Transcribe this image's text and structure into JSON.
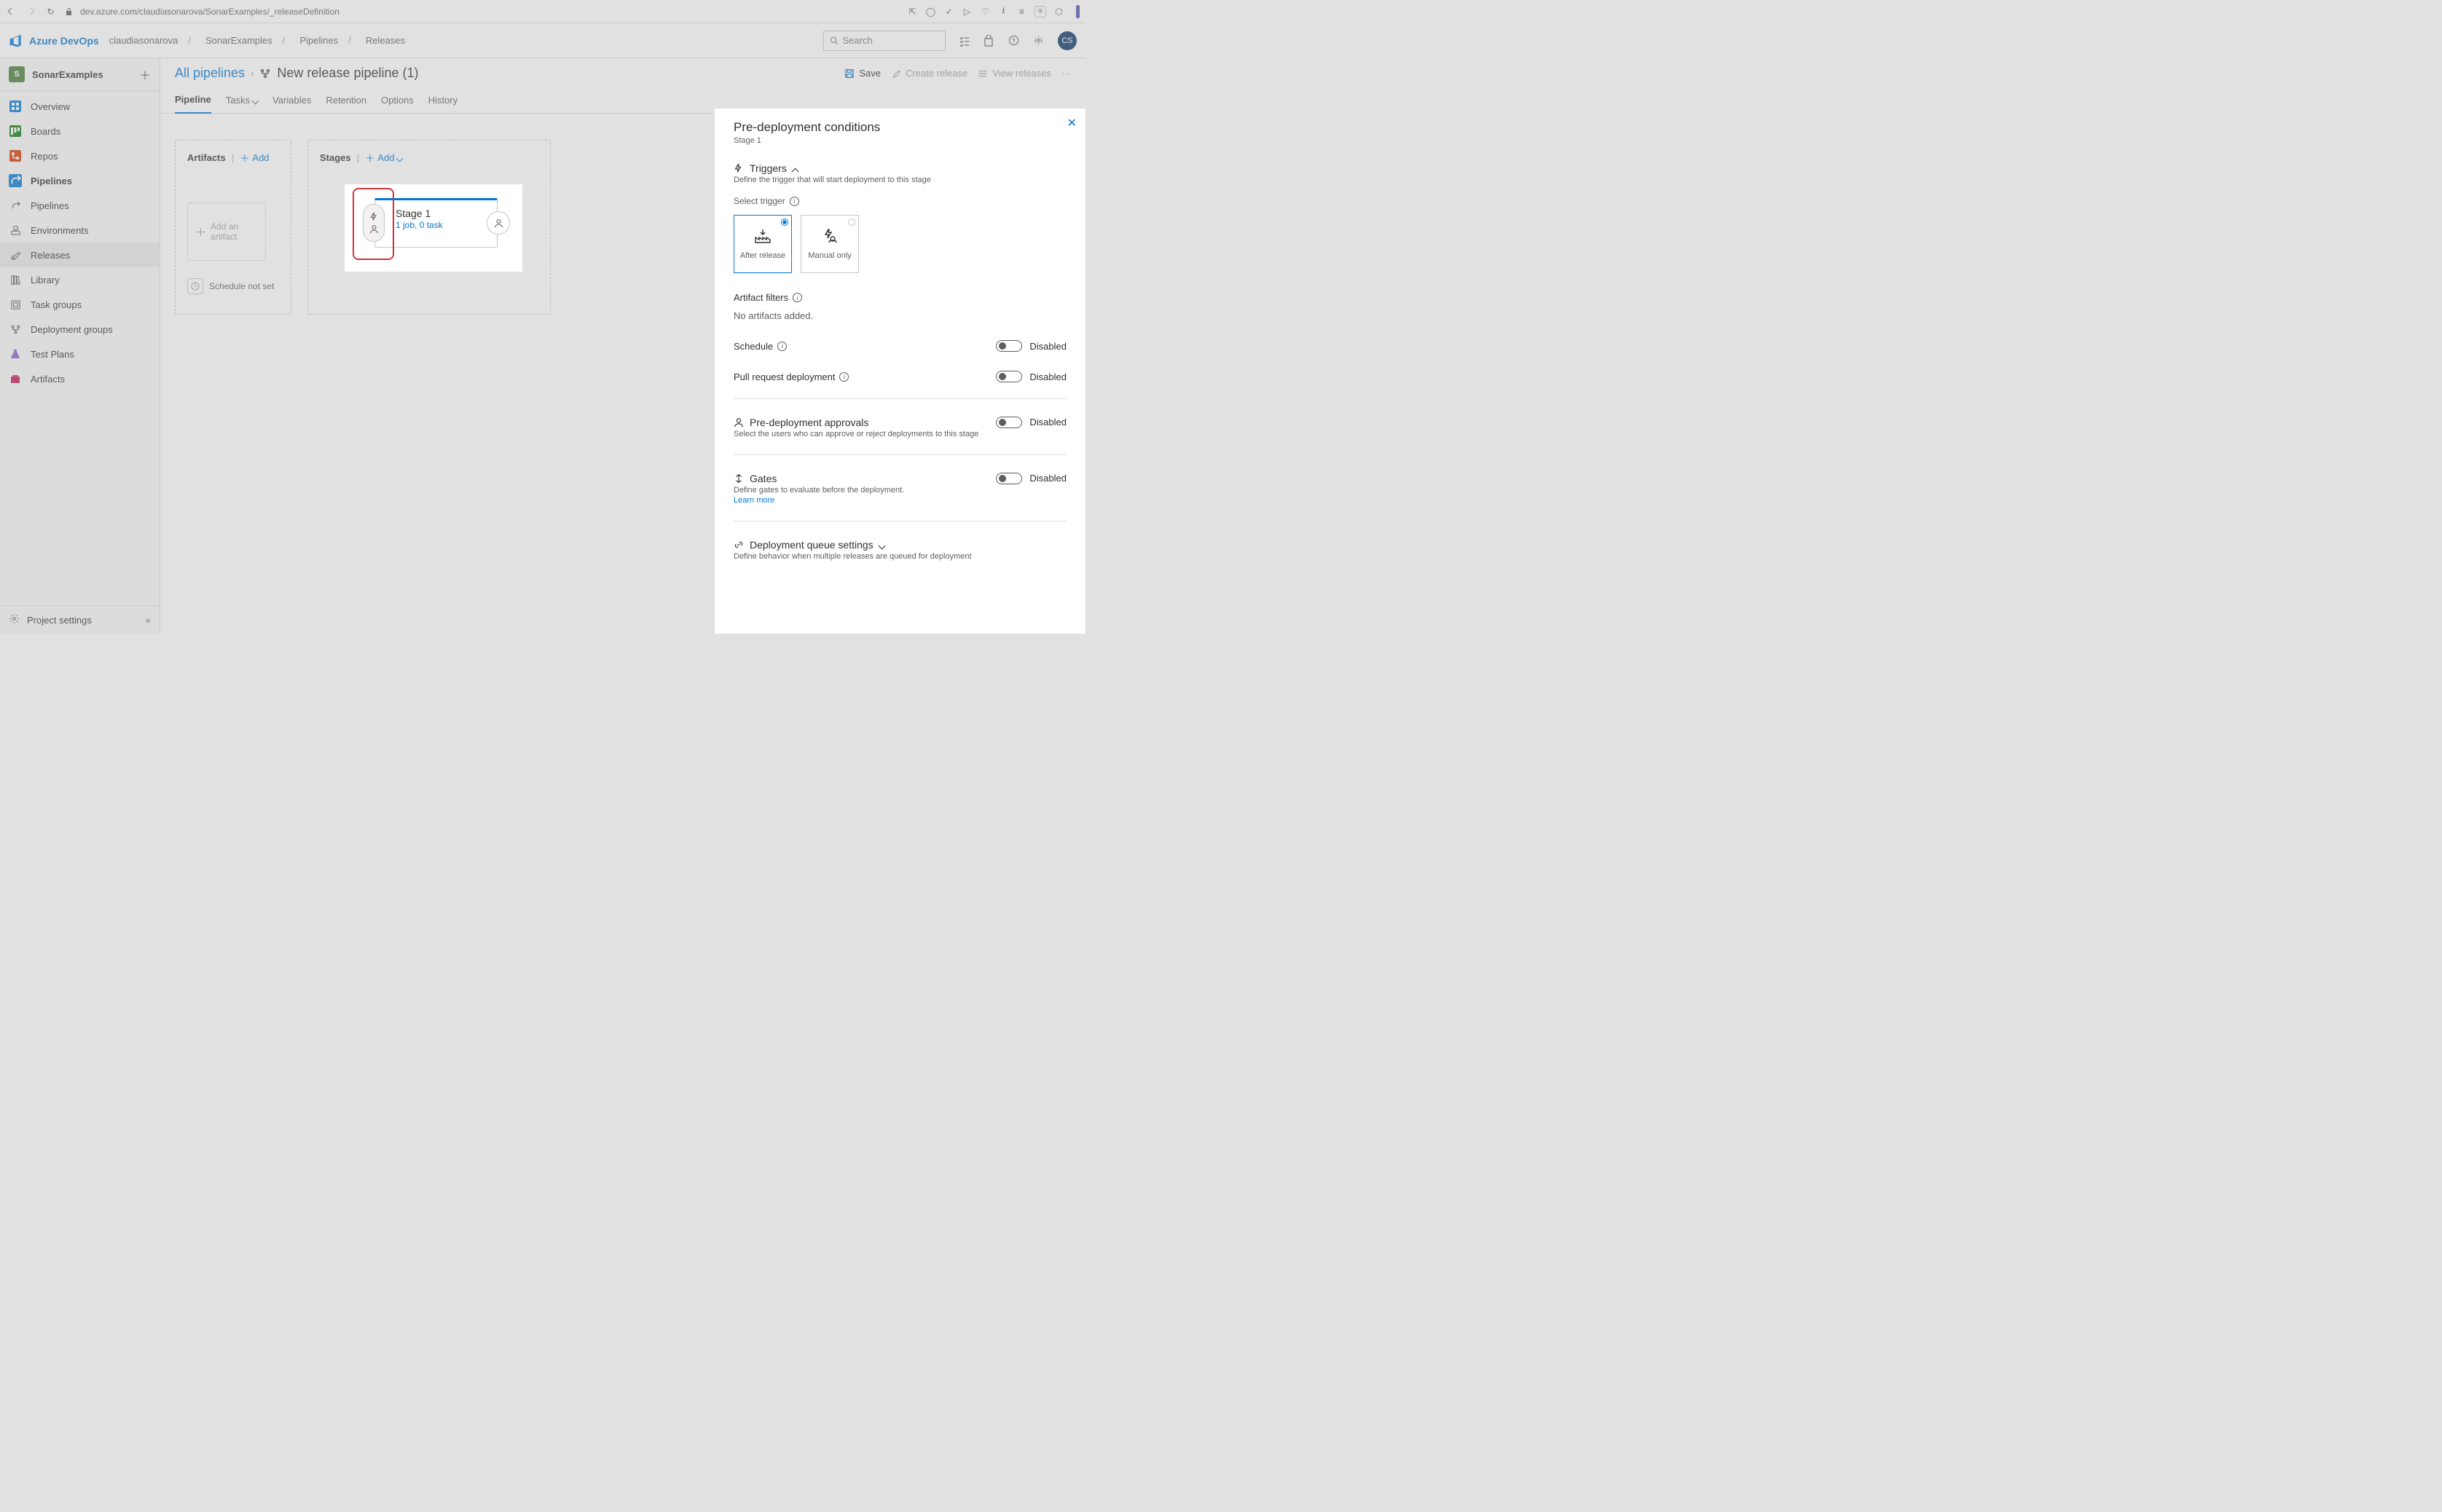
{
  "browser": {
    "url": "dev.azure.com/claudiasonarova/SonarExamples/_releaseDefinition"
  },
  "header": {
    "brand": "Azure DevOps",
    "org": "claudiasonarova",
    "project": "SonarExamples",
    "section": "Pipelines",
    "subsection": "Releases",
    "search_placeholder": "Search",
    "avatar": "CS"
  },
  "sidebar": {
    "project_initial": "S",
    "project_name": "SonarExamples",
    "items": {
      "overview": "Overview",
      "boards": "Boards",
      "repos": "Repos",
      "pipelines": "Pipelines",
      "pipelines_sub": "Pipelines",
      "environments": "Environments",
      "releases": "Releases",
      "library": "Library",
      "task_groups": "Task groups",
      "deployment_groups": "Deployment groups",
      "test_plans": "Test Plans",
      "artifacts": "Artifacts"
    },
    "project_settings": "Project settings"
  },
  "breadcrumb": {
    "all": "All pipelines",
    "title": "New release pipeline (1)"
  },
  "actions": {
    "save": "Save",
    "create_release": "Create release",
    "view_releases": "View releases"
  },
  "tabs": {
    "pipeline": "Pipeline",
    "tasks": "Tasks",
    "variables": "Variables",
    "retention": "Retention",
    "options": "Options",
    "history": "History"
  },
  "canvas": {
    "artifacts_title": "Artifacts",
    "stages_title": "Stages",
    "add": "Add",
    "add_artifact": "Add an artifact",
    "schedule": "Schedule not set",
    "stage_name": "Stage 1",
    "stage_jobs": "1 job, 0 task"
  },
  "panel": {
    "title": "Pre-deployment conditions",
    "subtitle": "Stage 1",
    "triggers": {
      "head": "Triggers",
      "sub": "Define the trigger that will start deployment to this stage",
      "select_label": "Select trigger",
      "after_release": "After release",
      "manual_only": "Manual only"
    },
    "artifact_filters": {
      "head": "Artifact filters",
      "body": "No artifacts added."
    },
    "schedule": {
      "head": "Schedule",
      "state": "Disabled"
    },
    "pull_request": {
      "head": "Pull request deployment",
      "state": "Disabled"
    },
    "approvals": {
      "head": "Pre-deployment approvals",
      "sub": "Select the users who can approve or reject deployments to this stage",
      "state": "Disabled"
    },
    "gates": {
      "head": "Gates",
      "sub": "Define gates to evaluate before the deployment.",
      "learn": "Learn more",
      "state": "Disabled"
    },
    "queue": {
      "head": "Deployment queue settings",
      "sub": "Define behavior when multiple releases are queued for deployment"
    }
  }
}
